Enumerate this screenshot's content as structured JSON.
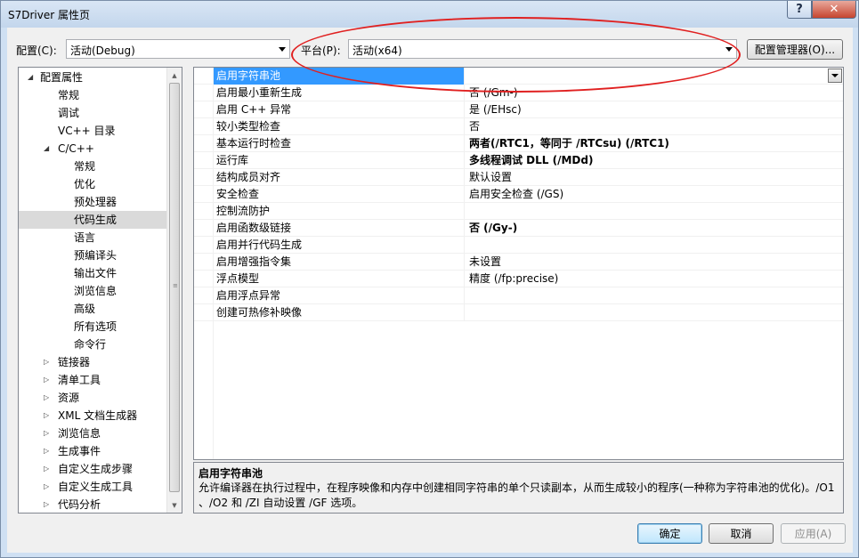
{
  "window": {
    "title": "S7Driver 属性页",
    "help_glyph": "?",
    "close_glyph": "✕"
  },
  "config_bar": {
    "config_label": "配置(C):",
    "config_value": "活动(Debug)",
    "platform_label": "平台(P):",
    "platform_value": "活动(x64)",
    "manager_button": "配置管理器(O)..."
  },
  "tree": {
    "items": [
      {
        "label": "配置属性",
        "expander": "◢"
      },
      {
        "label": "常规"
      },
      {
        "label": "调试"
      },
      {
        "label": "VC++ 目录"
      },
      {
        "label": "C/C++",
        "expander": "◢"
      },
      {
        "label": "常规"
      },
      {
        "label": "优化"
      },
      {
        "label": "预处理器"
      },
      {
        "label": "代码生成",
        "selected": true
      },
      {
        "label": "语言"
      },
      {
        "label": "预编译头"
      },
      {
        "label": "输出文件"
      },
      {
        "label": "浏览信息"
      },
      {
        "label": "高级"
      },
      {
        "label": "所有选项"
      },
      {
        "label": "命令行"
      },
      {
        "label": "链接器",
        "expander": "▷"
      },
      {
        "label": "清单工具",
        "expander": "▷"
      },
      {
        "label": "资源",
        "expander": "▷"
      },
      {
        "label": "XML 文档生成器",
        "expander": "▷"
      },
      {
        "label": "浏览信息",
        "expander": "▷"
      },
      {
        "label": "生成事件",
        "expander": "▷"
      },
      {
        "label": "自定义生成步骤",
        "expander": "▷"
      },
      {
        "label": "自定义生成工具",
        "expander": "▷"
      },
      {
        "label": "代码分析",
        "expander": "▷"
      }
    ],
    "scroll_up": "▲",
    "scroll_down": "▼",
    "grip": "≡"
  },
  "properties": [
    {
      "name": "启用字符串池",
      "value": "",
      "selected": true
    },
    {
      "name": "启用最小重新生成",
      "value": "否 (/Gm-)"
    },
    {
      "name": "启用 C++ 异常",
      "value": "是 (/EHsc)"
    },
    {
      "name": "较小类型检查",
      "value": "否"
    },
    {
      "name": "基本运行时检查",
      "value": "两者(/RTC1，等同于 /RTCsu) (/RTC1)",
      "bold": true
    },
    {
      "name": "运行库",
      "value": "多线程调试 DLL (/MDd)",
      "bold": true
    },
    {
      "name": "结构成员对齐",
      "value": "默认设置"
    },
    {
      "name": "安全检查",
      "value": "启用安全检查 (/GS)"
    },
    {
      "name": "控制流防护",
      "value": ""
    },
    {
      "name": "启用函数级链接",
      "value": "否 (/Gy-)",
      "bold": true
    },
    {
      "name": "启用并行代码生成",
      "value": ""
    },
    {
      "name": "启用增强指令集",
      "value": "未设置"
    },
    {
      "name": "浮点模型",
      "value": "精度 (/fp:precise)"
    },
    {
      "name": "启用浮点异常",
      "value": ""
    },
    {
      "name": "创建可热修补映像",
      "value": ""
    }
  ],
  "description": {
    "title": "启用字符串池",
    "text": "允许编译器在执行过程中，在程序映像和内存中创建相同字符串的单个只读副本，从而生成较小的程序(一种称为字符串池的优化)。/O1 、/O2 和 /ZI 自动设置 /GF 选项。"
  },
  "buttons": {
    "ok": "确定",
    "cancel": "取消",
    "apply": "应用(A)"
  },
  "annotation_color": "#e02020"
}
